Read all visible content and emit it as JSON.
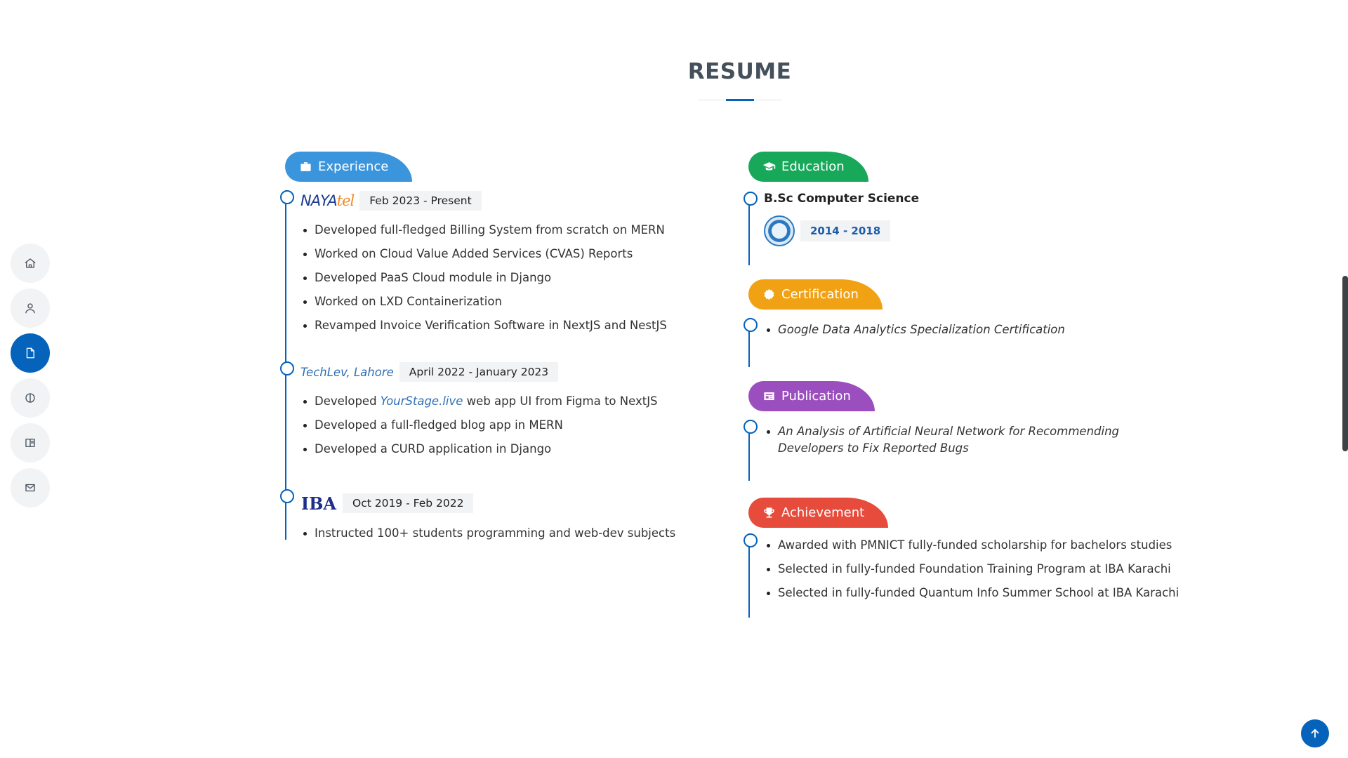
{
  "nav": [
    {
      "icon": "home-icon"
    },
    {
      "icon": "user-icon"
    },
    {
      "icon": "file-icon",
      "active": true
    },
    {
      "icon": "circle-half-icon"
    },
    {
      "icon": "book-icon"
    },
    {
      "icon": "mail-icon"
    }
  ],
  "section_title": "RESUME",
  "experience": {
    "label": "Experience",
    "items": [
      {
        "company_logo_text": "NAYAtel",
        "date": "Feb 2023 - Present",
        "bullets": [
          "Developed full-fledged Billing System from scratch on MERN",
          "Worked on Cloud Value Added Services (CVAS) Reports",
          "Developed PaaS Cloud module in Django",
          "Worked on LXD Containerization",
          "Revamped Invoice Verification Software in NextJS and NestJS"
        ]
      },
      {
        "company": "TechLev, Lahore",
        "date": "April 2022 - January 2023",
        "bullet1_prefix": "Developed ",
        "bullet1_link": "YourStage.live",
        "bullet1_suffix": " web app UI from Figma to NextJS",
        "bullets": [
          "Developed a full-fledged blog app in MERN",
          "Developed a CURD application in Django"
        ]
      },
      {
        "company_logo_text": "IBA",
        "date": "Oct 2019 - Feb 2022",
        "bullets": [
          "Instructed 100+ students programming and web-dev subjects"
        ]
      }
    ]
  },
  "education": {
    "label": "Education",
    "degree": "B.Sc Computer Science",
    "date": "2014 - 2018"
  },
  "certification": {
    "label": "Certification",
    "items": [
      "Google Data Analytics Specialization Certification"
    ]
  },
  "publication": {
    "label": "Publication",
    "items": [
      "An Analysis of Artificial Neural Network for Recommending Developers to Fix Reported Bugs"
    ]
  },
  "achievement": {
    "label": "Achievement",
    "items": [
      "Awarded with PMNICT fully-funded scholarship for bachelors studies",
      "Selected in fully-funded Foundation Training Program at IBA Karachi",
      "Selected in fully-funded Quantum Info Summer School at IBA Karachi"
    ]
  },
  "colors": {
    "primary": "#0563bb",
    "experience": "#3a95dd",
    "education": "#17a859",
    "certification": "#f1a114",
    "publication": "#9b4fbf",
    "achievement": "#e64b3c"
  }
}
